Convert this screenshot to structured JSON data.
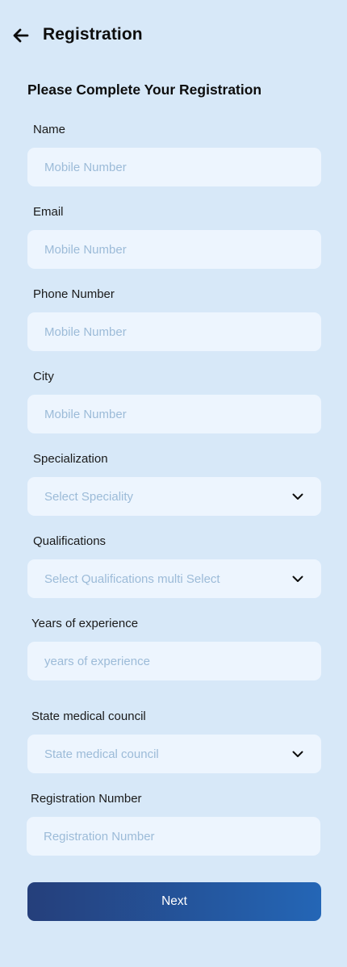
{
  "header": {
    "title": "Registration"
  },
  "form": {
    "heading": "Please Complete Your Registration",
    "name": {
      "label": "Name",
      "placeholder": "Mobile Number"
    },
    "email": {
      "label": "Email",
      "placeholder": "Mobile Number"
    },
    "phone": {
      "label": "Phone Number",
      "placeholder": "Mobile Number"
    },
    "city": {
      "label": "City",
      "placeholder": "Mobile Number"
    },
    "specialization": {
      "label": "Specialization",
      "placeholder": "Select Speciality"
    },
    "qualifications": {
      "label": "Qualifications",
      "placeholder": "Select Qualifications multi Select"
    },
    "experience": {
      "label": "Years of experience",
      "placeholder": "years of experience"
    },
    "council": {
      "label": "State medical council",
      "placeholder": "State medical council"
    },
    "registration_number": {
      "label": "Registration Number",
      "placeholder": "Registration Number"
    },
    "next_label": "Next"
  },
  "icons": {
    "back": "arrow-left-icon",
    "dropdown": "chevron-down-icon"
  },
  "colors": {
    "background": "#d7e8f8",
    "field": "#edf5fe",
    "placeholder": "#9cbbd8",
    "button_start": "#253f7b",
    "button_end": "#2466b6"
  }
}
